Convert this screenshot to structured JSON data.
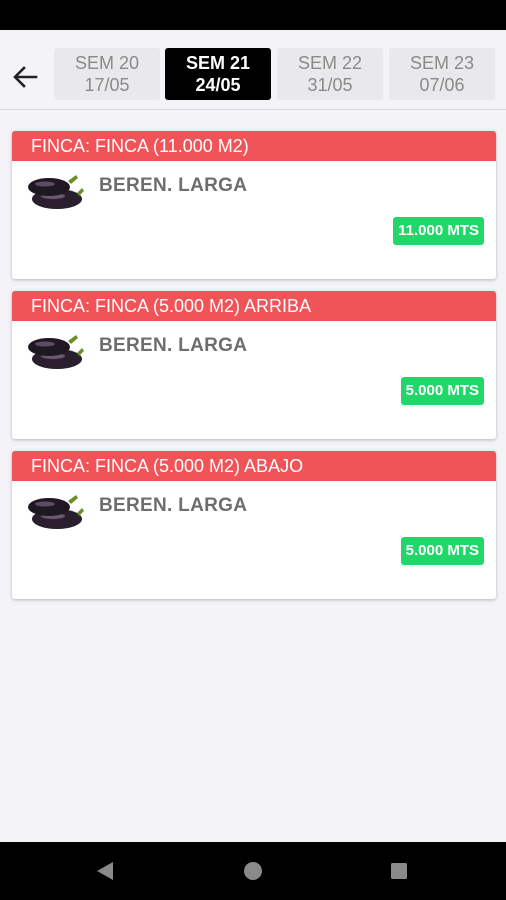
{
  "header": {
    "back_icon": "arrow-left-icon",
    "weeks": [
      {
        "week": "SEM 20",
        "date": "17/05",
        "active": false
      },
      {
        "week": "SEM 21",
        "date": "24/05",
        "active": true
      },
      {
        "week": "SEM 22",
        "date": "31/05",
        "active": false
      },
      {
        "week": "SEM 23",
        "date": "07/06",
        "active": false
      }
    ]
  },
  "cards": [
    {
      "finca": "FINCA: FINCA (11.000 M2)",
      "crop": "BEREN. LARGA",
      "crop_icon": "eggplant-icon",
      "amount": "11.000 MTS"
    },
    {
      "finca": "FINCA: FINCA (5.000 M2) ARRIBA",
      "crop": "BEREN. LARGA",
      "crop_icon": "eggplant-icon",
      "amount": "5.000 MTS"
    },
    {
      "finca": "FINCA: FINCA (5.000 M2) ABAJO",
      "crop": "BEREN. LARGA",
      "crop_icon": "eggplant-icon",
      "amount": "5.000 MTS"
    }
  ],
  "colors": {
    "header_bar": "#f05458",
    "badge": "#22d66a",
    "active_tab": "#000000"
  },
  "nav": {
    "back": "nav-back-icon",
    "home": "nav-home-icon",
    "recents": "nav-recents-icon"
  }
}
